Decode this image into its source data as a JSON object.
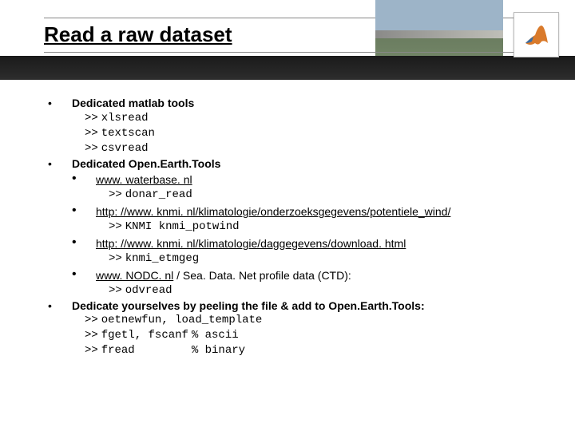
{
  "title": "Read a raw dataset",
  "sections": [
    {
      "heading": "Dedicated matlab tools",
      "codes": [
        {
          "prompt": ">>",
          "cmd": "xlsread"
        },
        {
          "prompt": ">>",
          "cmd": "textscan"
        },
        {
          "prompt": ">>",
          "cmd": "csvread"
        }
      ]
    },
    {
      "heading": "Dedicated Open.Earth.Tools",
      "subs": [
        {
          "link": "www. waterbase. nl",
          "prompt": ">>",
          "cmd": "donar_read"
        },
        {
          "link": "http: //www. knmi. nl/klimatologie/onderzoeksgegevens/potentiele_wind/",
          "prompt": ">>",
          "cmd": "KNMI knmi_potwind"
        },
        {
          "link": "http: //www. knmi. nl/klimatologie/daggegevens/download. html",
          "prompt": ">>",
          "cmd": "knmi_etmgeg"
        },
        {
          "link": "www. NODC. nl",
          "tail": " / Sea. Data. Net profile data (CTD):",
          "prompt": ">>",
          "cmd": "odvread"
        }
      ]
    },
    {
      "heading": "Dedicate yourselves by peeling the file & add to Open.Earth.Tools:",
      "codes": [
        {
          "prompt": ">>",
          "cmd": "oetnewfun, load_template"
        },
        {
          "prompt": ">>",
          "cmd": "fgetl, fscanf",
          "comment": "% ascii"
        },
        {
          "prompt": ">>",
          "cmd": "fread",
          "pad": "        ",
          "comment": "% binary"
        }
      ]
    }
  ]
}
